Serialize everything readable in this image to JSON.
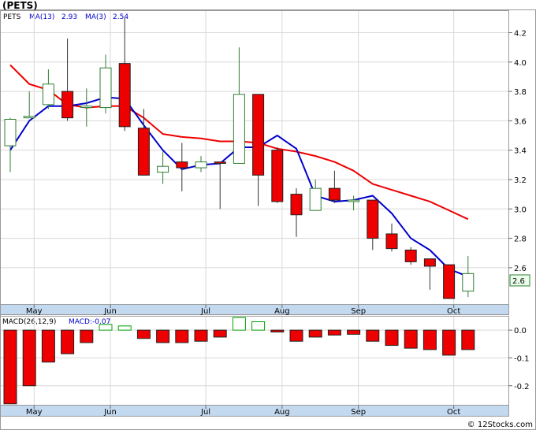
{
  "header": {
    "title": "(PETS)",
    "symbol_label": "PETS",
    "ma13_label": "MA(13)",
    "ma13_value": "2.93",
    "ma3_label": "MA(3)",
    "ma3_value": "2.54",
    "macd_label": "MACD(26,12,9)",
    "macd_value_label": "MACD:-0.07"
  },
  "price_badge": "2.6",
  "watermark": "© 12Stocks.com",
  "colors": {
    "up_candle": "#2e7d32",
    "down_candle": "#ee0000",
    "ma13_line": "#ee0000",
    "ma3_line": "#0000cc",
    "axis_band": "#c3d9f0",
    "macd_pos": "#00a000",
    "macd_neg": "#ee0000"
  },
  "chart_data": [
    {
      "type": "candlestick",
      "title": "(PETS)",
      "ylim": [
        2.35,
        4.35
      ],
      "yticks": [
        2.6,
        2.8,
        3.0,
        3.2,
        3.4,
        3.6,
        3.8,
        4.0,
        4.2
      ],
      "xlabels": [
        "May",
        "Jun",
        "Jul",
        "Aug",
        "Sep",
        "Oct"
      ],
      "x_label_weeks": [
        1.25,
        5.25,
        10.25,
        14.25,
        18.25,
        23.25
      ],
      "candles": [
        {
          "o": 3.43,
          "h": 3.62,
          "l": 3.25,
          "c": 3.61
        },
        {
          "o": 3.62,
          "h": 3.8,
          "l": 3.62,
          "c": 3.63
        },
        {
          "o": 3.71,
          "h": 3.95,
          "l": 3.68,
          "c": 3.85
        },
        {
          "o": 3.8,
          "h": 4.16,
          "l": 3.6,
          "c": 3.62
        },
        {
          "o": 3.69,
          "h": 3.82,
          "l": 3.56,
          "c": 3.7
        },
        {
          "o": 3.69,
          "h": 4.05,
          "l": 3.65,
          "c": 3.96
        },
        {
          "o": 3.99,
          "h": 4.3,
          "l": 3.53,
          "c": 3.56
        },
        {
          "o": 3.55,
          "h": 3.68,
          "l": 3.23,
          "c": 3.23
        },
        {
          "o": 3.25,
          "h": 3.39,
          "l": 3.17,
          "c": 3.29
        },
        {
          "o": 3.32,
          "h": 3.45,
          "l": 3.12,
          "c": 3.28
        },
        {
          "o": 3.28,
          "h": 3.36,
          "l": 3.25,
          "c": 3.32
        },
        {
          "o": 3.32,
          "h": 3.32,
          "l": 3.0,
          "c": 3.31
        },
        {
          "o": 3.31,
          "h": 4.1,
          "l": 3.31,
          "c": 3.78
        },
        {
          "o": 3.78,
          "h": 3.78,
          "l": 3.02,
          "c": 3.23
        },
        {
          "o": 3.4,
          "h": 3.42,
          "l": 3.04,
          "c": 3.05
        },
        {
          "o": 3.1,
          "h": 3.14,
          "l": 2.81,
          "c": 2.96
        },
        {
          "o": 2.99,
          "h": 3.2,
          "l": 2.99,
          "c": 3.14
        },
        {
          "o": 3.14,
          "h": 3.26,
          "l": 3.04,
          "c": 3.06
        },
        {
          "o": 3.05,
          "h": 3.09,
          "l": 2.99,
          "c": 3.06
        },
        {
          "o": 3.06,
          "h": 3.06,
          "l": 2.72,
          "c": 2.8
        },
        {
          "o": 2.83,
          "h": 2.9,
          "l": 2.71,
          "c": 2.73
        },
        {
          "o": 2.72,
          "h": 2.74,
          "l": 2.62,
          "c": 2.64
        },
        {
          "o": 2.66,
          "h": 2.66,
          "l": 2.45,
          "c": 2.61
        },
        {
          "o": 2.62,
          "h": 2.62,
          "l": 2.39,
          "c": 2.39
        },
        {
          "o": 2.44,
          "h": 2.68,
          "l": 2.4,
          "c": 2.56
        }
      ],
      "series": [
        {
          "name": "MA(13)",
          "start_week": 0,
          "values": [
            3.98,
            3.85,
            3.81,
            3.71,
            3.69,
            3.7,
            3.7,
            3.62,
            3.51,
            3.49,
            3.48,
            3.46,
            3.46,
            3.45,
            3.41,
            3.39,
            3.36,
            3.32,
            3.26,
            3.17,
            3.13,
            3.09,
            3.05,
            2.99,
            2.93
          ]
        },
        {
          "name": "MA(3)",
          "start_week": 0,
          "values": [
            3.4,
            3.6,
            3.7,
            3.7,
            3.72,
            3.76,
            3.75,
            3.57,
            3.4,
            3.27,
            3.3,
            3.31,
            3.42,
            3.42,
            3.5,
            3.41,
            3.09,
            3.05,
            3.06,
            3.09,
            2.97,
            2.8,
            2.72,
            2.59,
            2.54
          ]
        }
      ]
    },
    {
      "type": "bar",
      "title": "MACD(26,12,9)",
      "ylim": [
        -0.27,
        0.05
      ],
      "yticks": [
        0.0,
        -0.1,
        -0.2
      ],
      "values": [
        -0.265,
        -0.2,
        -0.115,
        -0.085,
        -0.045,
        0.02,
        0.015,
        -0.03,
        -0.045,
        -0.045,
        -0.04,
        -0.025,
        0.045,
        0.03,
        -0.007,
        -0.04,
        -0.025,
        -0.018,
        -0.015,
        -0.04,
        -0.055,
        -0.065,
        -0.07,
        -0.09,
        -0.07
      ]
    }
  ]
}
